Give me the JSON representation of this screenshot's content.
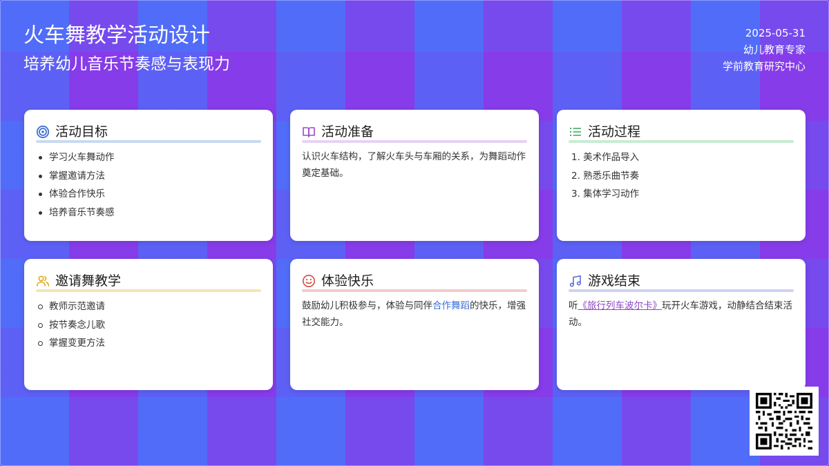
{
  "header": {
    "title": "火车舞教学活动设计",
    "subtitle": "培养幼儿音乐节奏感与表现力",
    "date": "2025-05-31",
    "author": "幼儿教育专家",
    "organization": "学前教育研究中心"
  },
  "cards": {
    "goals": {
      "title": "活动目标",
      "icon": "target-icon",
      "accent": "#c9d9f2",
      "items": [
        "学习火车舞动作",
        "掌握邀请方法",
        "体验合作快乐",
        "培养音乐节奏感"
      ]
    },
    "preparation": {
      "title": "活动准备",
      "icon": "book-icon",
      "accent": "#e7d2f3",
      "text": "认识火车结构，了解火车头与车厢的关系，为舞蹈动作奠定基础。"
    },
    "process": {
      "title": "活动过程",
      "icon": "list-icon",
      "accent": "#c8ecd3",
      "items": [
        "1. 美术作品导入",
        "2. 熟悉乐曲节奏",
        "3. 集体学习动作"
      ]
    },
    "invite": {
      "title": "邀请舞教学",
      "icon": "users-icon",
      "accent": "#f3e6b5",
      "items": [
        "教师示范邀请",
        "按节奏念儿歌",
        "掌握变更方法"
      ]
    },
    "joy": {
      "title": "体验快乐",
      "icon": "smile-icon",
      "accent": "#f3cccc",
      "text_before": "鼓励幼儿积极参与，体验与同伴",
      "text_link": "合作舞蹈",
      "text_after": "的快乐，增强社交能力。"
    },
    "ending": {
      "title": "游戏结束",
      "icon": "music-note-icon",
      "accent": "#cfd3f2",
      "text_before": "听",
      "text_link": "《旅行列车波尔卡》",
      "text_after": "玩开火车游戏，动静结合结束活动。"
    }
  },
  "qr": {
    "icon": "qr-code-icon"
  }
}
